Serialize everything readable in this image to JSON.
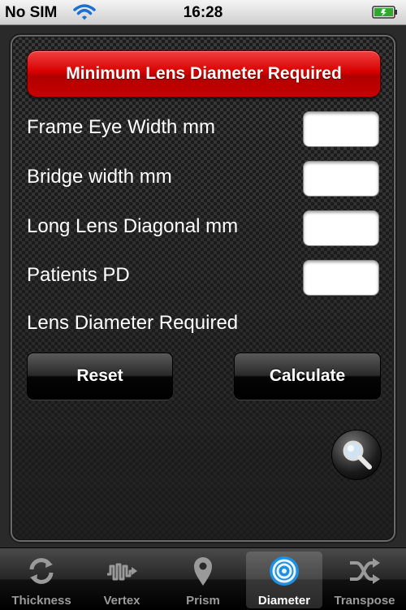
{
  "status_bar": {
    "carrier": "No SIM",
    "time": "16:28"
  },
  "header": {
    "title": "Minimum Lens Diameter Required"
  },
  "form": {
    "frame_eye_width": {
      "label": "Frame Eye Width mm",
      "value": ""
    },
    "bridge_width": {
      "label": "Bridge width mm",
      "value": ""
    },
    "long_lens_diagonal": {
      "label": "Long Lens Diagonal mm",
      "value": ""
    },
    "patients_pd": {
      "label": "Patients PD",
      "value": ""
    },
    "result_label": "Lens Diameter Required"
  },
  "buttons": {
    "reset": "Reset",
    "calculate": "Calculate"
  },
  "tabs": [
    {
      "label": "Thickness",
      "icon": "refresh-icon"
    },
    {
      "label": "Vertex",
      "icon": "wave-icon"
    },
    {
      "label": "Prism",
      "icon": "map-pin-icon"
    },
    {
      "label": "Diameter",
      "icon": "target-icon",
      "active": true
    },
    {
      "label": "Transpose",
      "icon": "shuffle-icon"
    }
  ],
  "colors": {
    "banner": "#d80000",
    "active_tab": "#ffffff",
    "battery": "#2ea82e"
  }
}
